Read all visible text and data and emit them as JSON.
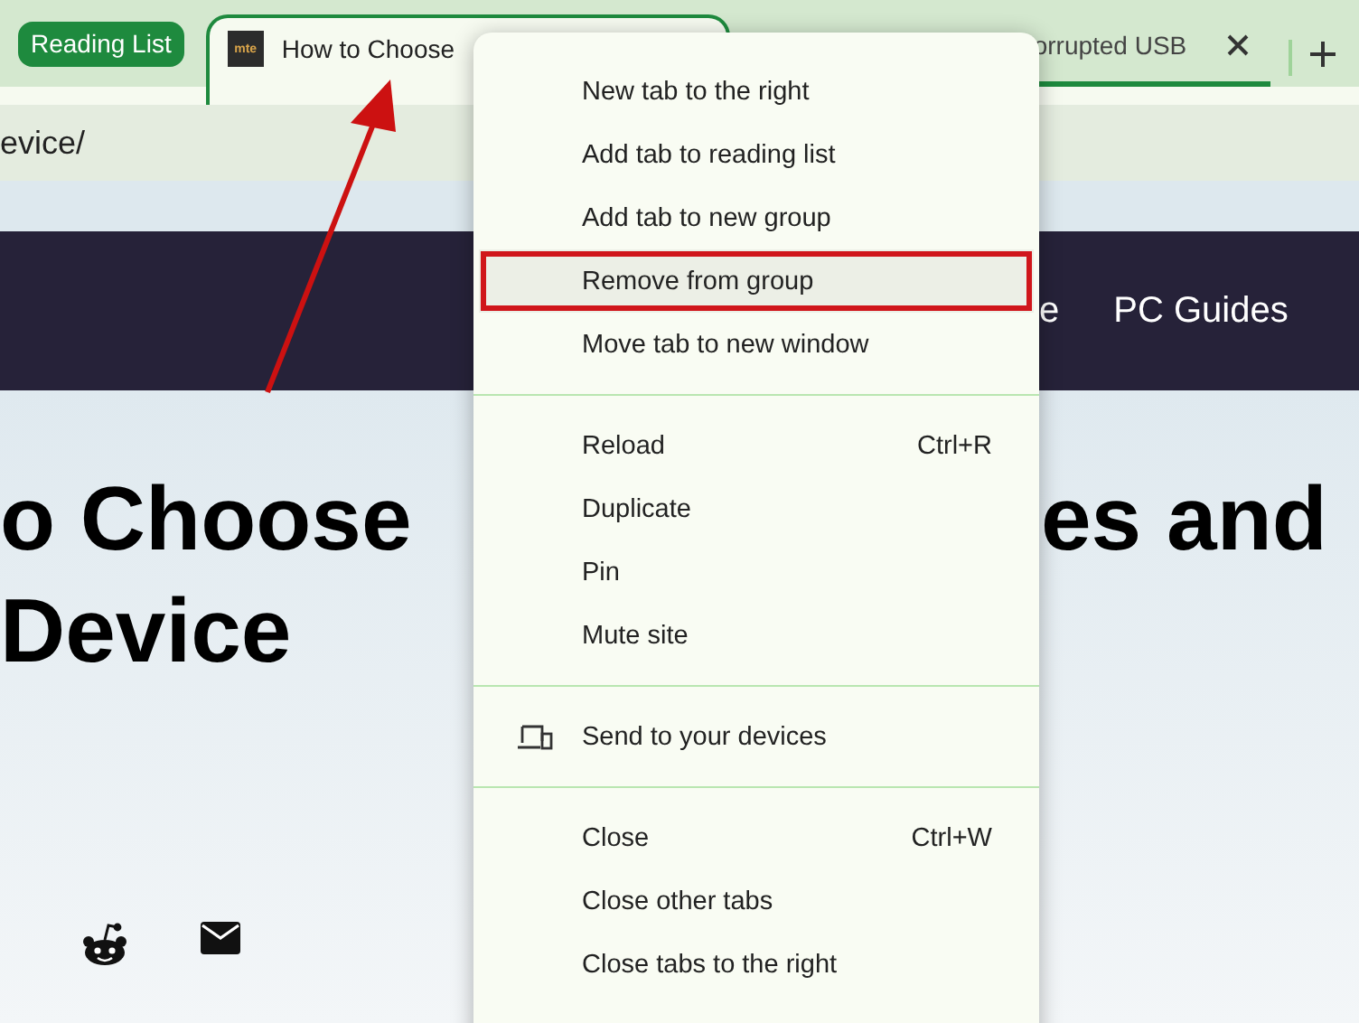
{
  "tab_strip": {
    "group": {
      "label": "Reading List"
    },
    "tabs": [
      {
        "favicon_text": "mte",
        "title": "How to Choose",
        "selected": true
      },
      {
        "title": "orrupted USB",
        "selected": false
      }
    ]
  },
  "address_bar": {
    "url": "evice/"
  },
  "site_nav": {
    "items": [
      "e",
      "PC Guides"
    ]
  },
  "article": {
    "title_line1_left": "o Choose",
    "title_line1_right": "es and",
    "title_line2": "Device"
  },
  "context_menu": {
    "sections": [
      [
        {
          "label": "New tab to the right",
          "highlighted": false,
          "outlined": false
        },
        {
          "label": "Add tab to reading list",
          "highlighted": false,
          "outlined": false
        },
        {
          "label": "Add tab to new group",
          "highlighted": false,
          "outlined": false
        },
        {
          "label": "Remove from group",
          "highlighted": true,
          "outlined": true
        },
        {
          "label": "Move tab to new window",
          "highlighted": false,
          "outlined": false
        }
      ],
      [
        {
          "label": "Reload",
          "shortcut": "Ctrl+R",
          "highlighted": false,
          "outlined": false
        },
        {
          "label": "Duplicate",
          "highlighted": false,
          "outlined": false
        },
        {
          "label": "Pin",
          "highlighted": false,
          "outlined": false
        },
        {
          "label": "Mute site",
          "highlighted": false,
          "outlined": false
        }
      ],
      [
        {
          "label": "Send to your devices",
          "kind": "devices",
          "highlighted": false,
          "outlined": false
        }
      ],
      [
        {
          "label": "Close",
          "shortcut": "Ctrl+W",
          "highlighted": false,
          "outlined": false
        },
        {
          "label": "Close other tabs",
          "highlighted": false,
          "outlined": false
        },
        {
          "label": "Close tabs to the right",
          "highlighted": false,
          "outlined": false
        }
      ]
    ]
  }
}
